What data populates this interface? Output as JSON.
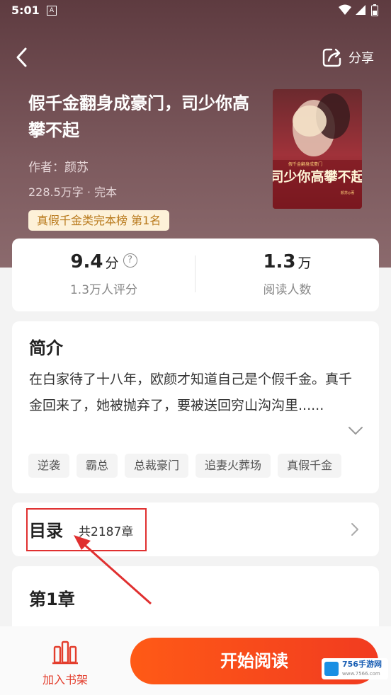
{
  "status_bar": {
    "time": "5:01",
    "notification_icon": "A"
  },
  "header": {
    "share_label": "分享"
  },
  "book": {
    "title": "假千金翻身成豪门，司少你高攀不起",
    "author_line": "作者：颜苏",
    "meta": "228.5万字 · 完本",
    "rank_badge": "真假千金类完本榜  第1名",
    "cover": {
      "title_text": "司少你高攀不起",
      "small_text": "假千金翻身成豪门",
      "author_mark": "颜苏◎著"
    }
  },
  "stats": {
    "score": "9.4",
    "score_unit": "分",
    "score_label": "1.3万人评分",
    "readers": "1.3",
    "readers_unit": "万",
    "readers_label": "阅读人数"
  },
  "intro": {
    "heading": "简介",
    "text": "在白家待了十八年，欧颜才知道自己是个假千金。真千金回来了，她被抛弃了，要被送回穷山沟沟里......",
    "tags": [
      "逆袭",
      "霸总",
      "总裁豪门",
      "追妻火葬场",
      "真假千金"
    ]
  },
  "toc": {
    "heading": "目录",
    "count": "共2187章"
  },
  "chapter": {
    "heading": "第1章"
  },
  "bottom": {
    "shelf_label": "加入书架",
    "read_label": "开始阅读"
  },
  "watermark": {
    "text": "756手游网",
    "sub": "www.7566.com"
  },
  "colors": {
    "accent": "#f13b20",
    "badge_bg": "#fdf1d8",
    "badge_text": "#b97a1d",
    "highlight": "#e03030"
  }
}
